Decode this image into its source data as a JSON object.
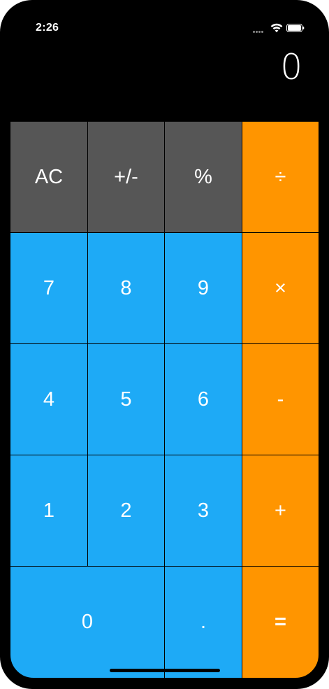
{
  "status_bar": {
    "time": "2:26"
  },
  "display": {
    "value": "0"
  },
  "keys": {
    "row1": [
      "AC",
      "+/-",
      "%",
      "÷"
    ],
    "row2": [
      "7",
      "8",
      "9",
      "×"
    ],
    "row3": [
      "4",
      "5",
      "6",
      "-"
    ],
    "row4": [
      "1",
      "2",
      "3",
      "+"
    ],
    "row5": [
      "0",
      ".",
      "="
    ]
  },
  "colors": {
    "function_key": "#565656",
    "number_key": "#1eaaf6",
    "operator_key": "#ff9500",
    "background": "#000000"
  },
  "icons": {
    "signal": "signal-icon",
    "wifi": "wifi-icon",
    "battery": "battery-icon"
  }
}
